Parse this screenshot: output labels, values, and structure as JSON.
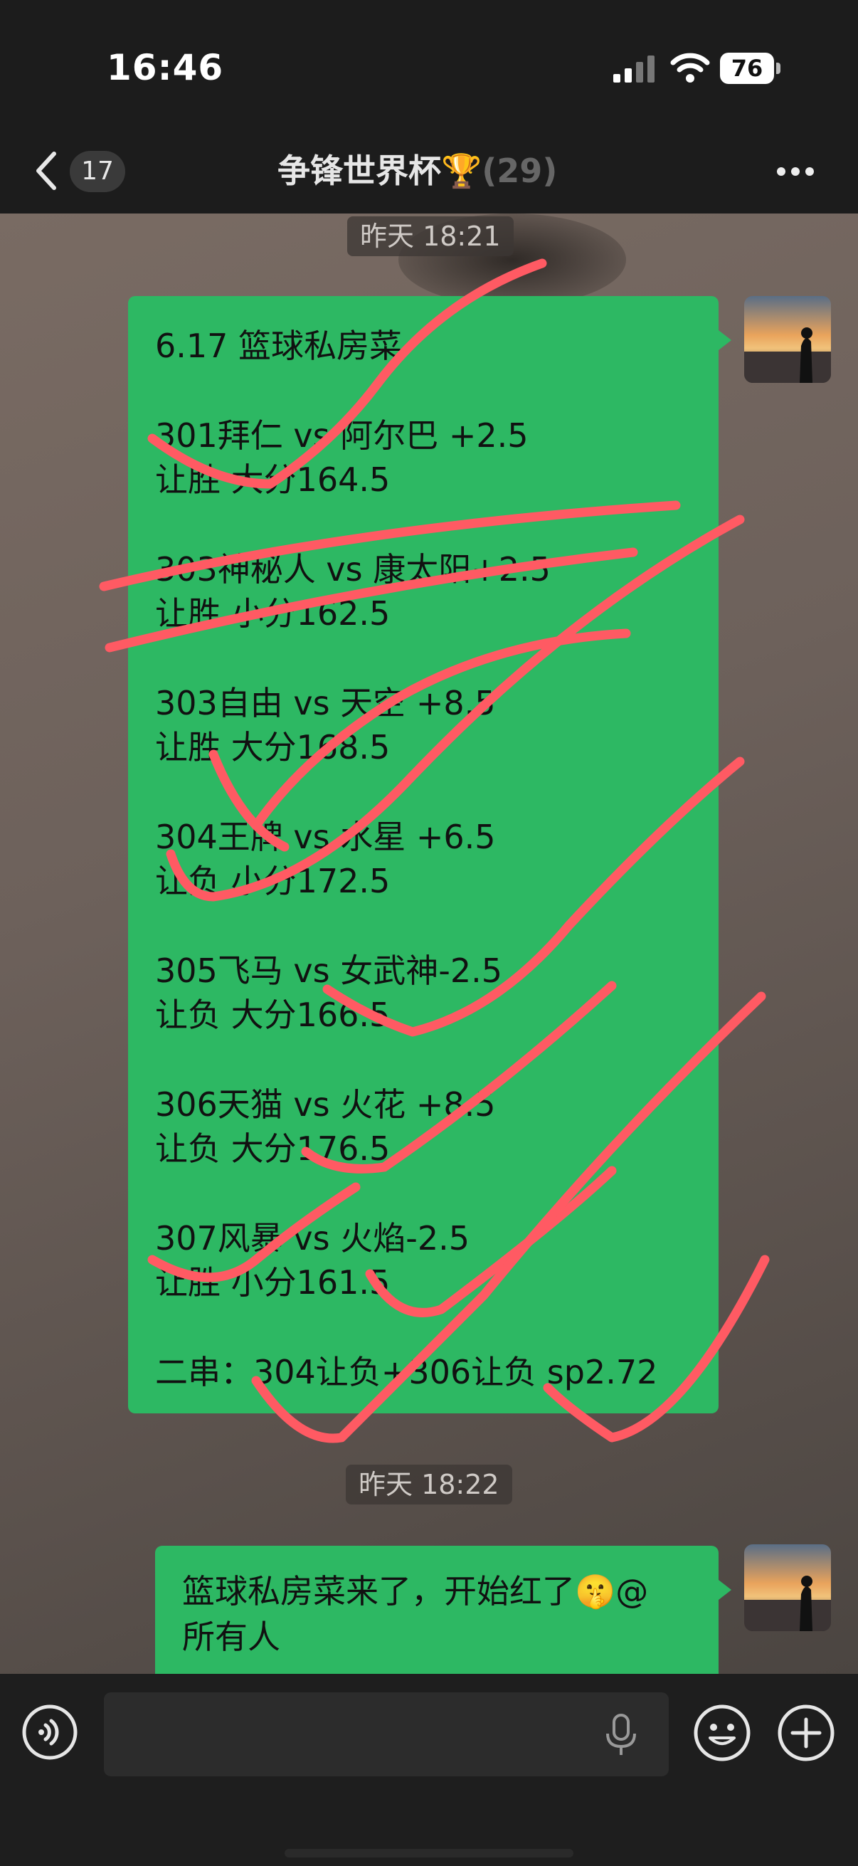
{
  "status_bar": {
    "time": "16:46",
    "battery": "76"
  },
  "nav": {
    "back_count": "17",
    "title": "争锋世界杯",
    "title_emoji": "🏆",
    "title_suffix": "(29)"
  },
  "messages": [
    {
      "timestamp": "昨天 18:21",
      "lines": [
        "6.17 篮球私房菜",
        "301拜仁 vs 阿尔巴 +2.5",
        "让胜 大分164.5",
        "303神秘人 vs 康太阳+2.5",
        "让胜 小分162.5",
        "303自由 vs 天空 +8.5",
        "让胜 大分168.5",
        "304王牌 vs 水星 +6.5",
        "让负 小分172.5",
        "305飞马 vs 女武神-2.5",
        "让负 大分166.5",
        "306天猫 vs 火花 +8.5",
        "让负 大分176.5",
        "307风暴 vs 火焰-2.5",
        "让胜 小分161.5",
        "二串：304让负+306让负 sp2.72"
      ]
    },
    {
      "timestamp": "昨天 18:22",
      "lines": [
        "篮球私房菜来了，开始红了🤫@",
        "所有人"
      ]
    }
  ],
  "icons": {
    "back": "chevron-left-icon",
    "more": "more-dots-icon",
    "voice": "voice-icon",
    "mic": "mic-icon",
    "emoji": "emoji-icon",
    "plus": "plus-icon"
  },
  "colors": {
    "bubble": "#2db863",
    "scribble": "#ff5a63",
    "bar": "#1c1c1c"
  }
}
